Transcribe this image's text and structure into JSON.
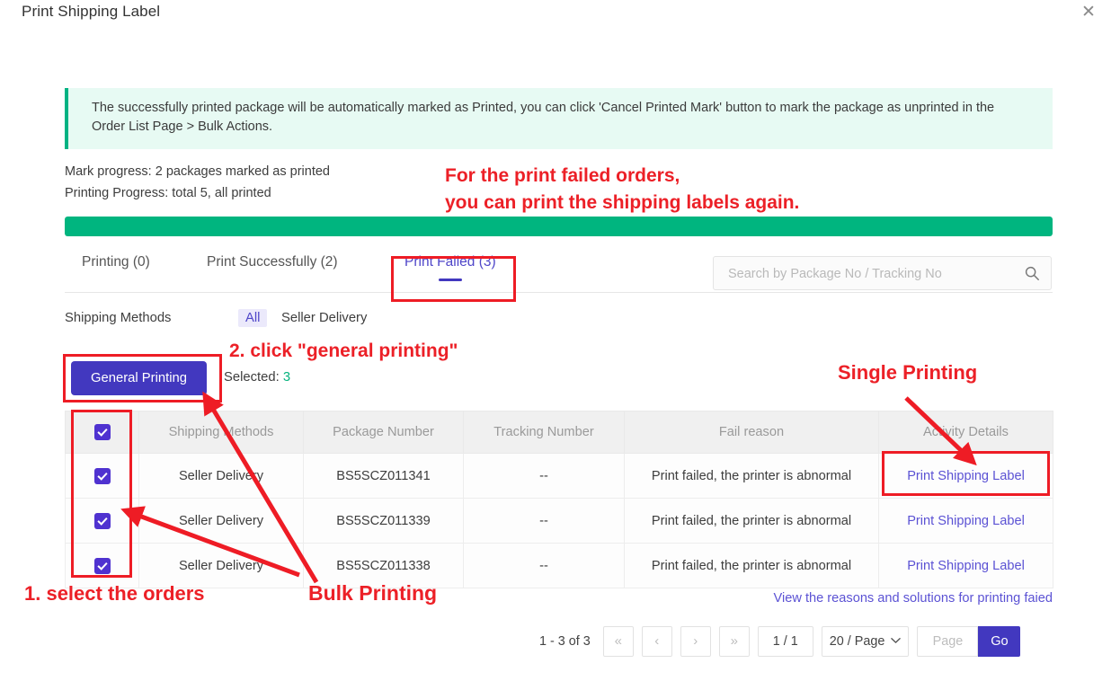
{
  "modal": {
    "title": "Print Shipping Label",
    "close_icon": "close-icon"
  },
  "banner": {
    "text": "The successfully printed package will be automatically marked as Printed, you can click 'Cancel Printed Mark' button to mark the package as unprinted in the Order List Page > Bulk Actions.",
    "accent_color": "#00b383",
    "background_color": "#e7faf3"
  },
  "progress": {
    "mark_progress": "Mark progress: 2 packages marked as printed",
    "printing_progress": "Printing Progress: total 5, all printed",
    "percent": 100,
    "bar_color": "#00b57f"
  },
  "tabs": [
    {
      "label": "Printing (0)",
      "active": false
    },
    {
      "label": "Print Successfully (2)",
      "active": false
    },
    {
      "label": "Print Failed (3)",
      "active": true
    }
  ],
  "search": {
    "placeholder": "Search by Package No / Tracking No",
    "value": "",
    "icon": "search-icon"
  },
  "filter": {
    "label": "Shipping Methods",
    "options": [
      {
        "label": "All",
        "selected": true
      },
      {
        "label": "Seller Delivery",
        "selected": false
      }
    ]
  },
  "actions": {
    "general_printing_label": "General Printing",
    "selected_prefix": "Selected: ",
    "selected_count": "3",
    "selected_count_color": "#06b37e",
    "button_color": "#4238bf"
  },
  "table": {
    "columns": [
      "",
      "Shipping Methods",
      "Package Number",
      "Tracking Number",
      "Fail reason",
      "Activity Details"
    ],
    "header_checkbox_checked": true,
    "rows": [
      {
        "checked": true,
        "shipping_method": "Seller Delivery",
        "package_number": "BS5SCZ011341",
        "tracking_number": "--",
        "fail_reason": "Print failed, the printer is abnormal",
        "activity_details": "Print Shipping Label"
      },
      {
        "checked": true,
        "shipping_method": "Seller Delivery",
        "package_number": "BS5SCZ011339",
        "tracking_number": "--",
        "fail_reason": "Print failed, the printer is abnormal",
        "activity_details": "Print Shipping Label"
      },
      {
        "checked": true,
        "shipping_method": "Seller Delivery",
        "package_number": "BS5SCZ011338",
        "tracking_number": "--",
        "fail_reason": "Print failed, the printer is abnormal",
        "activity_details": "Print Shipping Label"
      }
    ]
  },
  "footer": {
    "view_reasons_link": "View the reasons and solutions for printing faied",
    "pagination": {
      "range": "1 - 3 of 3",
      "first_icon": "«",
      "prev_icon": "‹",
      "next_icon": "›",
      "last_icon": "»",
      "current": "1 / 1",
      "page_size": "20 / Page",
      "page_size_caret": "⌄",
      "jump_placeholder": "Page",
      "jump_value": "",
      "go_label": "Go"
    }
  },
  "annotations": {
    "color": "#ec2027",
    "top_note": "For the print failed orders,\nyou can print the shipping labels again.",
    "step2": "2. click \"general printing\"",
    "single_printing": "Single Printing",
    "step1": "1. select the orders",
    "bulk_printing": "Bulk Printing"
  }
}
